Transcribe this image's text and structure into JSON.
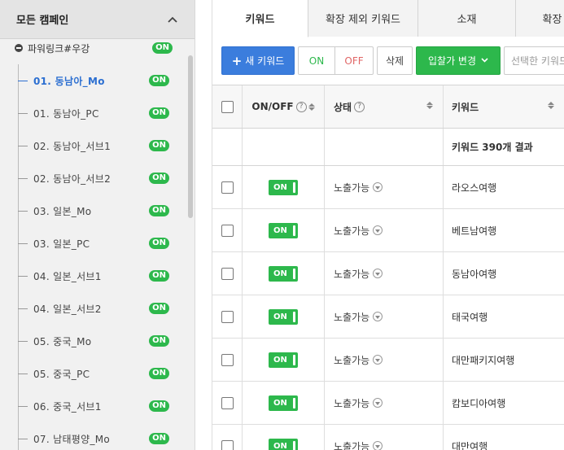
{
  "sidebar": {
    "header_title": "모든 캠페인",
    "group": {
      "label": "파워링크#우강",
      "badge": "ON"
    },
    "items": [
      {
        "label": "01. 동남아_Mo",
        "badge": "ON",
        "active": true
      },
      {
        "label": "01. 동남아_PC",
        "badge": "ON"
      },
      {
        "label": "02. 동남아_서브1",
        "badge": "ON"
      },
      {
        "label": "02. 동남아_서브2",
        "badge": "ON"
      },
      {
        "label": "03. 일본_Mo",
        "badge": "ON"
      },
      {
        "label": "03. 일본_PC",
        "badge": "ON"
      },
      {
        "label": "04. 일본_서브1",
        "badge": "ON"
      },
      {
        "label": "04. 일본_서브2",
        "badge": "ON"
      },
      {
        "label": "05. 중국_Mo",
        "badge": "ON"
      },
      {
        "label": "05. 중국_PC",
        "badge": "ON"
      },
      {
        "label": "06. 중국_서브1",
        "badge": "ON"
      },
      {
        "label": "07. 남태평양_Mo",
        "badge": "ON"
      }
    ]
  },
  "tabs": [
    {
      "label": "키워드",
      "active": true
    },
    {
      "label": "확장 제외 키워드"
    },
    {
      "label": "소재"
    },
    {
      "label": "확장"
    }
  ],
  "toolbar": {
    "new_keyword": "새 키워드",
    "on": "ON",
    "off": "OFF",
    "delete": "삭제",
    "bid_change": "입찰가 변경",
    "selected_placeholder": "선택한 키워드"
  },
  "table": {
    "headers": {
      "onoff": "ON/OFF",
      "state": "상태",
      "keyword": "키워드"
    },
    "summary": "키워드 390개 결과",
    "rows": [
      {
        "toggle": "ON",
        "state": "노출가능",
        "keyword": "라오스여행"
      },
      {
        "toggle": "ON",
        "state": "노출가능",
        "keyword": "베트남여행"
      },
      {
        "toggle": "ON",
        "state": "노출가능",
        "keyword": "동남아여행"
      },
      {
        "toggle": "ON",
        "state": "노출가능",
        "keyword": "태국여행"
      },
      {
        "toggle": "ON",
        "state": "노출가능",
        "keyword": "대만패키지여행"
      },
      {
        "toggle": "ON",
        "state": "노출가능",
        "keyword": "캄보디아여행"
      },
      {
        "toggle": "ON",
        "state": "노출가능",
        "keyword": "대만여행"
      }
    ]
  },
  "colors": {
    "accent_blue": "#3b7ddd",
    "on_green": "#2db84c",
    "off_red": "#e06666"
  }
}
